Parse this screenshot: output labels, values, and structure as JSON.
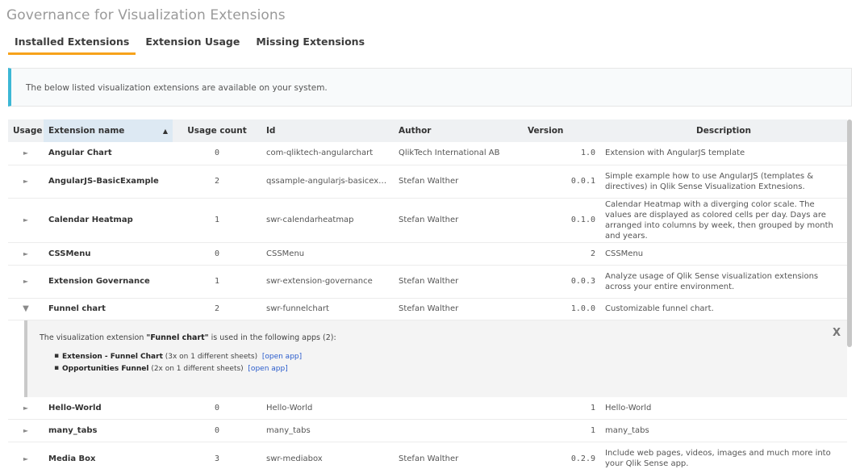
{
  "page": {
    "title": "Governance for Visualization Extensions"
  },
  "tabs": [
    {
      "label": "Installed Extensions",
      "active": true
    },
    {
      "label": "Extension Usage",
      "active": false
    },
    {
      "label": "Missing Extensions",
      "active": false
    }
  ],
  "info": {
    "text": "The below listed visualization extensions are available on your system."
  },
  "table": {
    "headers": {
      "usage": "Usage",
      "name": "Extension name",
      "count": "Usage count",
      "id": "Id",
      "author": "Author",
      "version": "Version",
      "description": "Description"
    },
    "rows": [
      {
        "expander": "►",
        "name": "Angular Chart",
        "count": "0",
        "id": "com-qliktech-angularchart",
        "author": "QlikTech International AB",
        "version": "1.0",
        "description": "Extension with AngularJS template"
      },
      {
        "expander": "►",
        "name": "AngularJS-BasicExample",
        "count": "2",
        "id": "qssample-angularjs-basicexam...",
        "author": "Stefan Walther",
        "version": "0.0.1",
        "description": "Simple example how to use AngularJS (templates & directives) in Qlik Sense Visualization Extnesions."
      },
      {
        "expander": "►",
        "name": "Calendar Heatmap",
        "count": "1",
        "id": "swr-calendarheatmap",
        "author": "Stefan Walther",
        "version": "0.1.0",
        "description": "Calendar Heatmap with a diverging color scale. The values are displayed as colored cells per day. Days are arranged into columns by week, then grouped by month and years."
      },
      {
        "expander": "►",
        "name": "CSSMenu",
        "count": "0",
        "id": "CSSMenu",
        "author": "",
        "version": "2",
        "description": "CSSMenu"
      },
      {
        "expander": "►",
        "name": "Extension Governance",
        "count": "1",
        "id": "swr-extension-governance",
        "author": "Stefan Walther",
        "version": "0.0.3",
        "description": "Analyze usage of Qlik Sense visualization extensions across your entire environment."
      },
      {
        "expander": "▼",
        "name": "Funnel chart",
        "count": "2",
        "id": "swr-funnelchart",
        "author": "Stefan Walther",
        "version": "1.0.0",
        "description": "Customizable funnel chart."
      },
      {
        "expander": "►",
        "name": "Hello-World",
        "count": "0",
        "id": "Hello-World",
        "author": "",
        "version": "1",
        "description": "Hello-World"
      },
      {
        "expander": "►",
        "name": "many_tabs",
        "count": "0",
        "id": "many_tabs",
        "author": "",
        "version": "1",
        "description": "many_tabs"
      },
      {
        "expander": "►",
        "name": "Media Box",
        "count": "3",
        "id": "swr-mediabox",
        "author": "Stefan Walther",
        "version": "0.2.9",
        "description": "Include web pages, videos, images and much more into your Qlik Sense app."
      }
    ]
  },
  "detail": {
    "intro_prefix": "The visualization extension ",
    "extension_name": "\"Funnel chart\"",
    "intro_suffix": " is used in the following apps (2):",
    "close_label": "X",
    "apps": [
      {
        "name": "Extension - Funnel Chart",
        "usage": " (3x on 1 different sheets)",
        "link": "[open app]"
      },
      {
        "name": "Opportunities Funnel",
        "usage": " (2x on 1 different sheets)",
        "link": "[open app]"
      }
    ]
  },
  "colors": {
    "tab_active_underline": "#f7a21b",
    "info_accent": "#3cb7d5",
    "link": "#2a5ccc"
  },
  "icons": {
    "sort": "sort-ascending-icon",
    "collapsed": "chevron-right-icon",
    "expanded": "chevron-down-icon",
    "close": "close-icon"
  }
}
